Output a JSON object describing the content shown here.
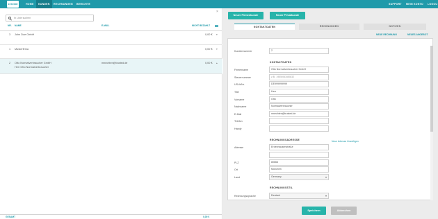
{
  "nav": {
    "logo": "zervant",
    "items": [
      "HOME",
      "KUNDEN",
      "RECHNUNGEN",
      "BERICHTE"
    ],
    "right_items": [
      "SUPPORT",
      "MEIN KONTO",
      "LOGOU"
    ]
  },
  "list": {
    "search_placeholder": "In Liste suchen",
    "columns": {
      "nr": "NR.",
      "name": "NAME",
      "email": "E-MAIL",
      "balance": "NICHT BEZAHLT"
    },
    "rows": [
      {
        "nr": "3",
        "name": "John Doe GmbH",
        "name2": "",
        "email": "",
        "amount": "0,00 €"
      },
      {
        "nr": "1",
        "name": "Musterfirma",
        "name2": "",
        "email": "",
        "amount": "0,00 €"
      },
      {
        "nr": "2",
        "name": "Otto Normalverbraucher GmbH",
        "name2": "Herr Otto Normalverbraucher",
        "email": "mnechten@trusted.de",
        "amount": "0,00 €"
      }
    ],
    "footer_left": "GESAMT",
    "footer_right": "0,00 €"
  },
  "detail": {
    "btn_new_company": "Neuer Firmenkunde",
    "btn_new_private": "Neuer Privatkunde",
    "tabs": [
      "KONTAKTDATEN",
      "RECHNUNGEN",
      "NOTIZEN"
    ],
    "link_new_invoice": "NEUE RECHNUNG",
    "link_new_quote": "NEUES ANGEBOT",
    "customer_number_label": "Kundennummer",
    "customer_number": "2",
    "section_contact": "KONTAKTDATEN",
    "firm_label": "Firmenname",
    "firm_value": "Otto Normalverbraucher GmbH",
    "tax_label": "Steuernummer",
    "tax_value": "z.B. 1955/063/80832",
    "vat_label": "USt-IdNr.",
    "vat_value": "DE999999999",
    "title_label": "Titel",
    "title_value": "Herr",
    "firstname_label": "Vorname",
    "firstname_value": "Otto",
    "lastname_label": "Nachname",
    "lastname_value": "Normalverbraucher",
    "email_label": "E-Mail",
    "email_value": "mnechten@trusted.de",
    "phone_label": "Telefon",
    "phone_value": "",
    "mobile_label": "Handy",
    "mobile_value": "",
    "section_address": "RECHNUNGSADRESSE",
    "link_new_address": "Neue Adresse hinzufügen",
    "address_label": "Adresse",
    "address_value": "Erdenhausenstraße",
    "address2_value": "",
    "zip_label": "PLZ",
    "zip_value": "80666",
    "city_label": "Ort",
    "city_value": "München",
    "country_label": "Land",
    "country_value": "Germany",
    "section_invoice": "RECHNUNGSSTIL",
    "lang_label": "Rechnungssprache",
    "lang_value": "Deutsch",
    "btn_save": "Speichern",
    "btn_cancel": "Abbrechen"
  },
  "colors": {
    "accent": "#1f9aaa",
    "primary_button": "#27b4aa",
    "cancel_button": "#bfbfbf",
    "selected_row": "#e8f5f7"
  }
}
